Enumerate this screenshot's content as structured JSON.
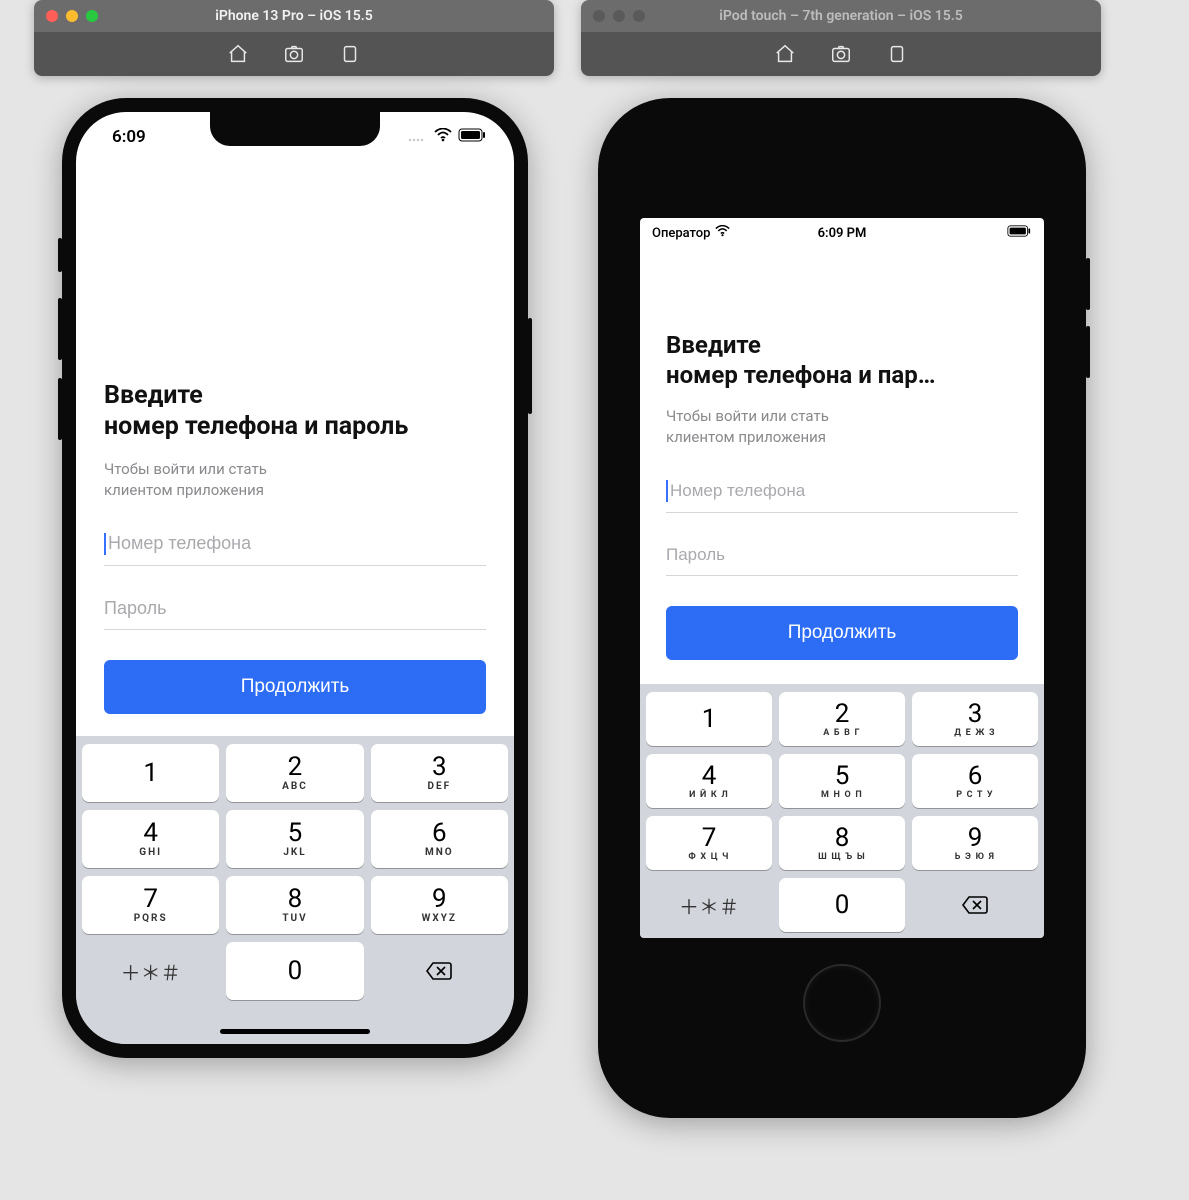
{
  "simulators": {
    "left": {
      "title": "iPhone 13 Pro – iOS 15.5",
      "active": true
    },
    "right": {
      "title": "iPod touch – 7th generation – iOS 15.5",
      "active": false
    }
  },
  "status": {
    "iphone": {
      "time": "6:09"
    },
    "ipod": {
      "carrier": "Оператор",
      "time": "6:09 PM"
    }
  },
  "screen": {
    "heading_line1": "Введите",
    "heading_line2": "номер телефона и пароль",
    "heading_line2_truncated": "номер телефона и пар…",
    "subtitle": "Чтобы войти или стать\nклиентом приложения",
    "phone_placeholder": "Номер телефона",
    "password_placeholder": "Пароль",
    "cta": "Продолжить"
  },
  "keypad_en": [
    [
      {
        "n": "1",
        "s": ""
      },
      {
        "n": "2",
        "s": "ABC"
      },
      {
        "n": "3",
        "s": "DEF"
      }
    ],
    [
      {
        "n": "4",
        "s": "GHI"
      },
      {
        "n": "5",
        "s": "JKL"
      },
      {
        "n": "6",
        "s": "MNO"
      }
    ],
    [
      {
        "n": "7",
        "s": "PQRS"
      },
      {
        "n": "8",
        "s": "TUV"
      },
      {
        "n": "9",
        "s": "WXYZ"
      }
    ]
  ],
  "keypad_ru": [
    [
      {
        "n": "1",
        "s": ""
      },
      {
        "n": "2",
        "s": "А Б В Г"
      },
      {
        "n": "3",
        "s": "Д Е Ж З"
      }
    ],
    [
      {
        "n": "4",
        "s": "И Й К Л"
      },
      {
        "n": "5",
        "s": "М Н О П"
      },
      {
        "n": "6",
        "s": "Р С Т У"
      }
    ],
    [
      {
        "n": "7",
        "s": "Ф Х Ц Ч"
      },
      {
        "n": "8",
        "s": "Ш Щ Ъ Ы"
      },
      {
        "n": "9",
        "s": "Ь Э Ю Я"
      }
    ]
  ],
  "keypad_bottom": {
    "sym": "＋＊＃",
    "zero": "0"
  }
}
